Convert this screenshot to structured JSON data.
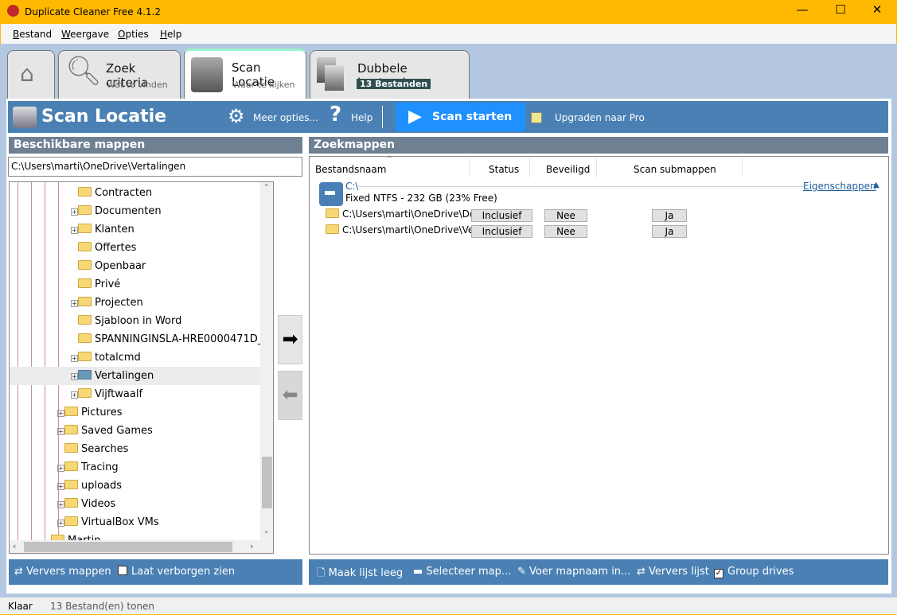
{
  "window": {
    "title": "Duplicate Cleaner Free 4.1.2",
    "minimize": "—",
    "maximize": "☐",
    "close": "✕"
  },
  "menu": [
    "Bestand",
    "Weergave",
    "Opties",
    "Help"
  ],
  "tabs": [
    {
      "name": "home"
    },
    {
      "title": "Zoek criteria",
      "subtitle": "Wat te vinden"
    },
    {
      "title": "Scan Locatie",
      "subtitle": "Waar te kijken"
    },
    {
      "title": "Dubbele bestanden",
      "badge": "13 Bestanden"
    }
  ],
  "header": {
    "title": "Scan Locatie",
    "more_options": "Meer opties...",
    "help": "Help",
    "scan": "Scan starten",
    "upgrade": "Upgraden naar Pro"
  },
  "left": {
    "title": "Beschikbare mappen",
    "path": "C:\\Users\\marti\\OneDrive\\Vertalingen",
    "tree": [
      {
        "label": "Contracten",
        "level": 2,
        "expandable": false
      },
      {
        "label": "Documenten",
        "level": 2,
        "expandable": true
      },
      {
        "label": "Klanten",
        "level": 2,
        "expandable": true
      },
      {
        "label": "Offertes",
        "level": 2,
        "expandable": false
      },
      {
        "label": "Openbaar",
        "level": 2,
        "expandable": false
      },
      {
        "label": "Privé",
        "level": 2,
        "expandable": false
      },
      {
        "label": "Projecten",
        "level": 2,
        "expandable": true
      },
      {
        "label": "Sjabloon in Word",
        "level": 2,
        "expandable": false
      },
      {
        "label": "SPANNINGINSLA-HRE0000471D_",
        "level": 2,
        "expandable": false
      },
      {
        "label": "totalcmd",
        "level": 2,
        "expandable": true
      },
      {
        "label": "Vertalingen",
        "level": 2,
        "expandable": true,
        "selected": true
      },
      {
        "label": "Vijftwaalf",
        "level": 2,
        "expandable": true
      },
      {
        "label": "Pictures",
        "level": 1,
        "expandable": true
      },
      {
        "label": "Saved Games",
        "level": 1,
        "expandable": true
      },
      {
        "label": "Searches",
        "level": 1,
        "expandable": false
      },
      {
        "label": "Tracing",
        "level": 1,
        "expandable": true
      },
      {
        "label": "uploads",
        "level": 1,
        "expandable": true
      },
      {
        "label": "Videos",
        "level": 1,
        "expandable": true
      },
      {
        "label": "VirtualBox VMs",
        "level": 1,
        "expandable": true
      },
      {
        "label": "Martin",
        "level": 0,
        "expandable": false
      }
    ],
    "refresh": "Ververs mappen",
    "show_hidden": "Laat verborgen zien"
  },
  "right": {
    "title": "Zoekmappen",
    "columns": [
      "Bestandsnaam",
      "Status",
      "Beveiligd",
      "Scan submappen"
    ],
    "drive": {
      "name": "C:\\",
      "info": "Fixed NTFS - 232 GB (23% Free)",
      "properties": "Eigenschappen"
    },
    "rows": [
      {
        "path": "C:\\Users\\marti\\OneDrive\\Do...",
        "status": "Inclusief",
        "protected": "Nee",
        "subfolders": "Ja"
      },
      {
        "path": "C:\\Users\\marti\\OneDrive\\Ve...",
        "status": "Inclusief",
        "protected": "Nee",
        "subfolders": "Ja"
      }
    ],
    "toolbar": {
      "clear": "Maak lijst leeg",
      "select": "Selecteer map...",
      "enter": "Voer mapnaam in...",
      "refresh": "Ververs lijst",
      "group": "Group drives"
    }
  },
  "status": {
    "state": "Klaar",
    "count": "13 Bestand(en) tonen"
  }
}
